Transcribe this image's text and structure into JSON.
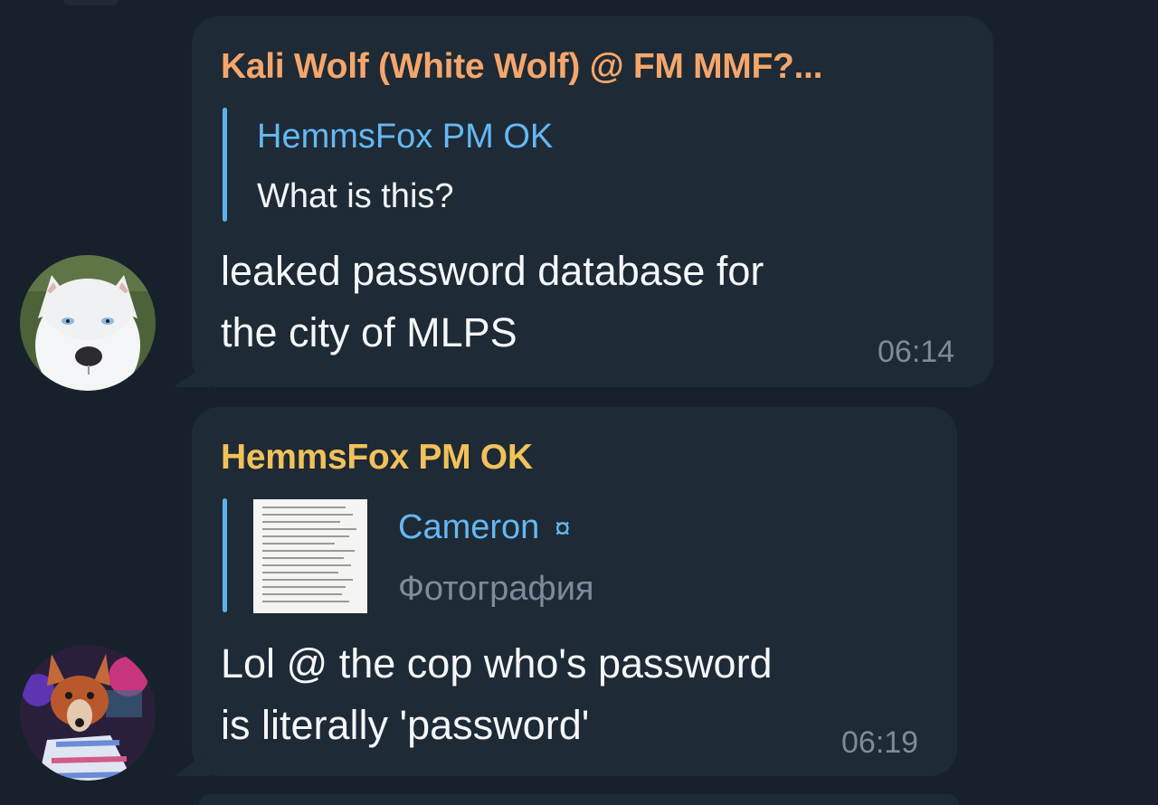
{
  "messages": [
    {
      "sender": "Kali Wolf (White Wolf) @ FM MMF?...",
      "sender_color": "#f5a66c",
      "reply": {
        "name": "HemmsFox PM OK",
        "text": "What is this?"
      },
      "text": "leaked password database for\nthe city of MLPS",
      "time": "06:14",
      "avatar": "white-husky-avatar"
    },
    {
      "sender": "HemmsFox PM OK",
      "sender_color": "#f1c15a",
      "reply": {
        "name": "Cameron",
        "name_icon": "¤",
        "text": "Фотография",
        "thumbnail": "photo-thumbnail"
      },
      "text": "Lol @ the cop who's password\nis literally 'password'",
      "time": "06:19",
      "avatar": "fox-fursuit-avatar"
    }
  ],
  "colors": {
    "background": "#17212b",
    "bubble": "#1e2a35",
    "reply_accent": "#5ab2ec",
    "time": "#7b8c9b"
  }
}
